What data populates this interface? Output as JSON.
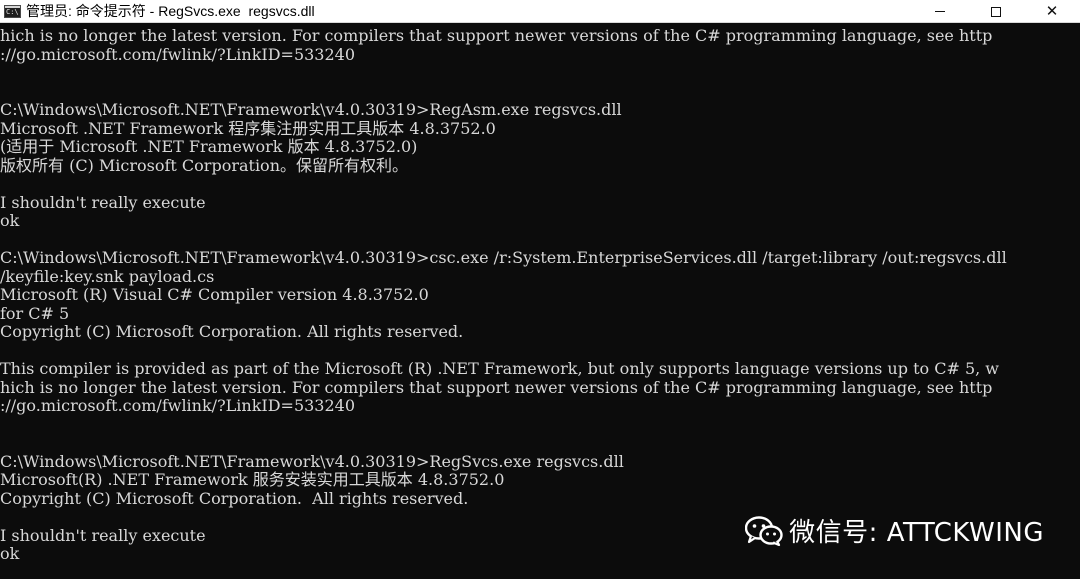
{
  "window": {
    "title": "管理员: 命令提示符 - RegSvcs.exe  regsvcs.dll",
    "minimize_icon": "minimize-icon",
    "maximize_icon": "maximize-icon",
    "close_icon": "close-icon",
    "close_glyph": "✕"
  },
  "console": {
    "lines": [
      "hich is no longer the latest version. For compilers that support newer versions of the C# programming language, see http",
      "://go.microsoft.com/fwlink/?LinkID=533240",
      "",
      "",
      "C:\\Windows\\Microsoft.NET\\Framework\\v4.0.30319>RegAsm.exe regsvcs.dll",
      "Microsoft .NET Framework 程序集注册实用工具版本 4.8.3752.0",
      "(适用于 Microsoft .NET Framework 版本 4.8.3752.0)",
      "版权所有 (C) Microsoft Corporation。保留所有权利。",
      "",
      "I shouldn't really execute",
      "ok",
      "",
      "C:\\Windows\\Microsoft.NET\\Framework\\v4.0.30319>csc.exe /r:System.EnterpriseServices.dll /target:library /out:regsvcs.dll",
      "/keyfile:key.snk payload.cs",
      "Microsoft (R) Visual C# Compiler version 4.8.3752.0",
      "for C# 5",
      "Copyright (C) Microsoft Corporation. All rights reserved.",
      "",
      "This compiler is provided as part of the Microsoft (R) .NET Framework, but only supports language versions up to C# 5, w",
      "hich is no longer the latest version. For compilers that support newer versions of the C# programming language, see http",
      "://go.microsoft.com/fwlink/?LinkID=533240",
      "",
      "",
      "C:\\Windows\\Microsoft.NET\\Framework\\v4.0.30319>RegSvcs.exe regsvcs.dll",
      "Microsoft(R) .NET Framework 服务安装实用工具版本 4.8.3752.0",
      "Copyright (C) Microsoft Corporation.  All rights reserved.",
      "",
      "I shouldn't really execute",
      "ok"
    ]
  },
  "watermark": {
    "text": "微信号: ATTCKWING",
    "icon": "wechat-icon"
  },
  "colors": {
    "console_bg": "#0c0c0c",
    "console_text": "#d8d8d8",
    "titlebar_bg": "#ffffff"
  }
}
